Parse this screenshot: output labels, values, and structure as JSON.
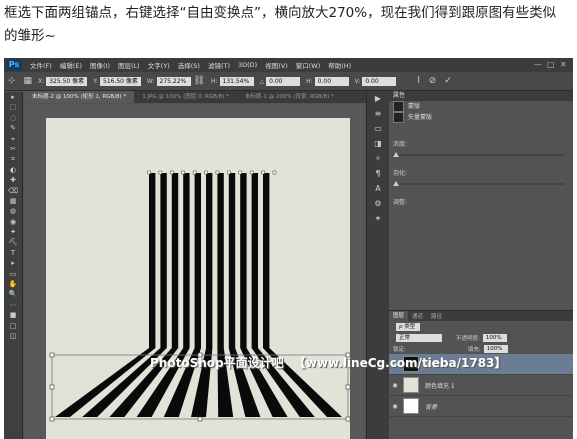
{
  "caption": {
    "line1": "框选下面两组锚点，右键选择“自由变换点”，横向放大270%，现在我们得到跟原图有些类似",
    "line2": "的雏形~"
  },
  "app": {
    "logo": "Ps",
    "menu": [
      "文件(F)",
      "编辑(E)",
      "图像(I)",
      "图层(L)",
      "文字(Y)",
      "选择(S)",
      "滤镜(T)",
      "3D(D)",
      "视图(V)",
      "窗口(W)",
      "帮助(H)"
    ],
    "window_controls": [
      "—",
      "□",
      "✕"
    ]
  },
  "options": {
    "x_label": "X:",
    "x_value": "325.50 像素",
    "y_label": "Y:",
    "y_value": "516.50 像素",
    "w_label": "W:",
    "w_value": "275.22%",
    "h_label": "H:",
    "h_value": "131.54%",
    "angle_label": "△",
    "angle_value": "0.00",
    "hskew_label": "H:",
    "hskew_value": "0.00",
    "vskew_label": "V:",
    "vskew_value": "0.00",
    "icons": [
      "move-icon",
      "grid-icon",
      "link-icon",
      "warp-icon",
      "cancel-icon",
      "commit-icon"
    ]
  },
  "tabs": [
    {
      "label": "未标题-2 @ 100% (矩形 1, RGB/8) *",
      "active": true
    },
    {
      "label": "1.JPG @ 100% (图层 0, RGB/8) *",
      "active": false
    },
    {
      "label": "未标题-1 @ 200% (背景, RGB/8) *",
      "active": false
    }
  ],
  "tools": [
    "▸",
    "⬚",
    "◌",
    "✎",
    "⌖",
    "✂",
    "⌗",
    "◐",
    "✚",
    "⌫",
    "▦",
    "◍",
    "◉",
    "✦",
    "⛏",
    "T",
    "▸",
    "▭",
    "✋",
    "🔍",
    "⋯",
    "■",
    "□",
    "◫"
  ],
  "mid_icons": [
    "▶",
    "≡",
    "▭",
    "◨",
    "✧",
    "¶",
    "A",
    "⚙",
    "✶"
  ],
  "properties": {
    "tab": "属性",
    "rows": [
      "蒙版",
      "矢量蒙版"
    ],
    "density_label": "浓度:",
    "feather_label": "羽化:",
    "adjust_label": "调整:"
  },
  "layers_panel": {
    "tabs": [
      "图层",
      "通道",
      "路径"
    ],
    "kind_label": "ρ 类型",
    "mode": "正常",
    "opacity_label": "不透明度:",
    "opacity_value": "100%",
    "lock_label": "锁定:",
    "fill_label": "填充:",
    "fill_value": "100%",
    "layers": [
      {
        "name": "矩形 1",
        "thumb": "dark",
        "selected": true
      },
      {
        "name": "颜色填充 1",
        "thumb": "light",
        "selected": false
      },
      {
        "name": "背景",
        "thumb": "white",
        "selected": false,
        "italic": true
      }
    ]
  },
  "watermark": {
    "text1": "PhotoShop平面设计吧",
    "text2": "【www.lineCg.com/tieba/1783】"
  },
  "colors": {
    "canvas_bg": "#e2e3d8",
    "stripe": "#0a0a0a",
    "ui_bg": "#535353",
    "selected_layer": "#6b7d94"
  }
}
